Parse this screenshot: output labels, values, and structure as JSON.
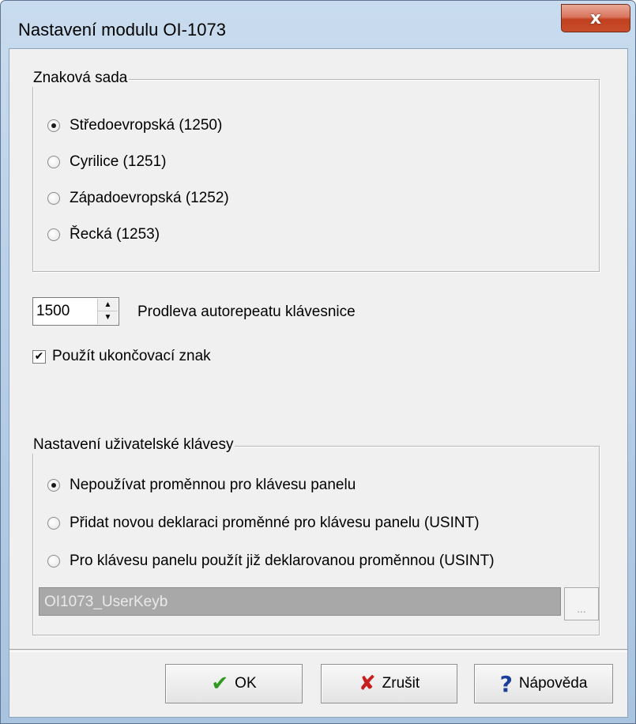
{
  "window": {
    "title": "Nastavení modulu OI-1073",
    "close_label": "x"
  },
  "charset_group": {
    "legend": "Znaková sada",
    "options": [
      {
        "label": "Středoevropská (1250)",
        "selected": true
      },
      {
        "label": "Cyrilice (1251)",
        "selected": false
      },
      {
        "label": "Západoevropská (1252)",
        "selected": false
      },
      {
        "label": "Řecká (1253)",
        "selected": false
      }
    ]
  },
  "autorepeat": {
    "value": "1500",
    "label": "Prodleva autorepeatu klávesnice"
  },
  "terminator": {
    "label": "Použít ukončovací znak",
    "checked": true
  },
  "user_key_group": {
    "legend": "Nastavení uživatelské klávesy",
    "options": [
      {
        "label": "Nepoužívat proměnnou pro klávesu panelu",
        "selected": true
      },
      {
        "label": "Přidat novou deklaraci proměnné pro klávesu panelu (USINT)",
        "selected": false
      },
      {
        "label": "Pro klávesu panelu použít již deklarovanou proměnnou (USINT)",
        "selected": false
      }
    ],
    "variable_value": "OI1073_UserKeyb",
    "browse_label": "..."
  },
  "buttons": {
    "ok_label": "OK",
    "cancel_label": "Zrušit",
    "help_label": "Nápověda"
  },
  "icons": {
    "ok": "checkmark-icon",
    "cancel": "red-x-icon",
    "help": "question-mark-icon"
  },
  "colors": {
    "ok_icon": "#2f9a1f",
    "cancel_icon": "#c81e1e",
    "help_icon": "#1a3f9c",
    "close_button": "#c84d2c"
  }
}
